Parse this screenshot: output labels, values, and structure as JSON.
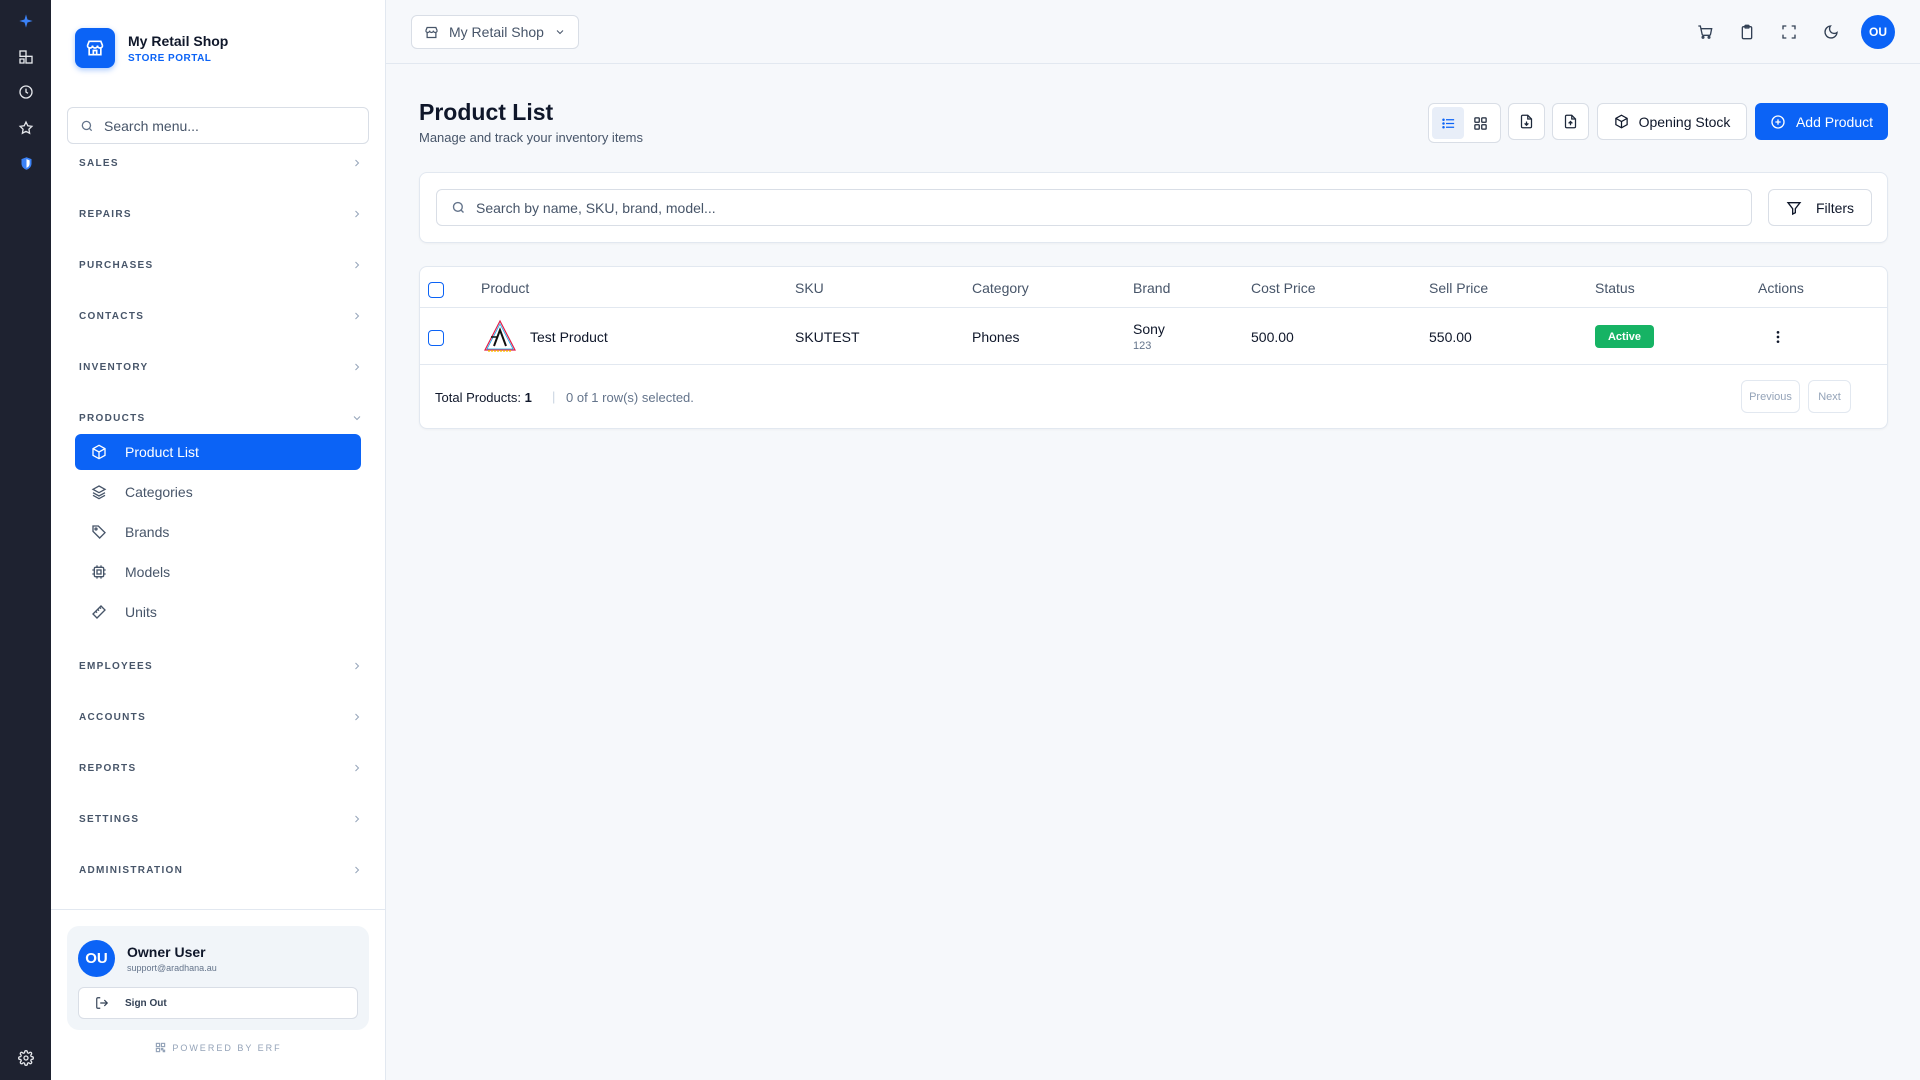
{
  "app": {
    "shop_name": "My Retail Shop",
    "portal_label": "STORE PORTAL",
    "brand_color": "#0b63f6"
  },
  "rail": {
    "icons": [
      "sparkle-icon",
      "dashboard-icon",
      "history-icon",
      "star-icon",
      "shield-icon",
      "settings-icon"
    ]
  },
  "sidebar": {
    "search_placeholder": "Search menu...",
    "sections": [
      {
        "label": "SALES"
      },
      {
        "label": "REPAIRS"
      },
      {
        "label": "PURCHASES"
      },
      {
        "label": "CONTACTS"
      },
      {
        "label": "INVENTORY"
      },
      {
        "label": "PRODUCTS",
        "expanded": true
      },
      {
        "label": "EMPLOYEES"
      },
      {
        "label": "ACCOUNTS"
      },
      {
        "label": "REPORTS"
      },
      {
        "label": "SETTINGS"
      },
      {
        "label": "ADMINISTRATION"
      }
    ],
    "product_items": [
      {
        "label": "Product List",
        "icon": "box-icon",
        "active": true
      },
      {
        "label": "Categories",
        "icon": "layers-icon"
      },
      {
        "label": "Brands",
        "icon": "tag-icon"
      },
      {
        "label": "Models",
        "icon": "cpu-icon"
      },
      {
        "label": "Units",
        "icon": "ruler-icon"
      }
    ],
    "user": {
      "initials": "OU",
      "name": "Owner User",
      "email": "support@aradhana.au",
      "sign_out": "Sign Out"
    },
    "powered_by": "POWERED BY ERF"
  },
  "topbar": {
    "shop_selector": "My Retail Shop",
    "icons": [
      "cart-icon",
      "clipboard-icon",
      "fullscreen-icon",
      "moon-icon"
    ],
    "avatar_initials": "OU"
  },
  "page": {
    "title": "Product List",
    "subtitle": "Manage and track your inventory items",
    "opening_stock": "Opening Stock",
    "add_product": "Add Product",
    "search_placeholder": "Search by name, SKU, brand, model...",
    "filters": "Filters"
  },
  "table": {
    "columns": [
      "Product",
      "SKU",
      "Category",
      "Brand",
      "Cost Price",
      "Sell Price",
      "Status",
      "Actions"
    ],
    "rows": [
      {
        "product": "Test Product",
        "sku": "SKUTEST",
        "category": "Phones",
        "brand": "Sony",
        "brand_code": "123",
        "cost_price": "500.00",
        "sell_price": "550.00",
        "status": "Active",
        "status_color": "#16b364"
      }
    ],
    "total_label": "Total Products:",
    "total_value": "1",
    "selection": "0 of 1 row(s) selected.",
    "previous": "Previous",
    "next": "Next"
  }
}
